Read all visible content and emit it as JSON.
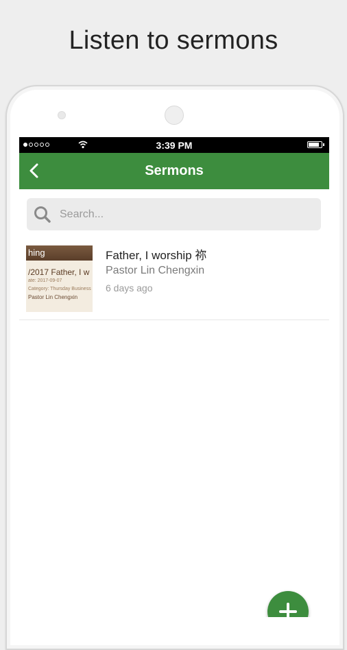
{
  "headline": "Listen to sermons",
  "status_bar": {
    "time": "3:39 PM",
    "signal_icon": "signal-dots-icon",
    "wifi_icon": "wifi-icon",
    "battery_icon": "battery-icon"
  },
  "app_bar": {
    "title": "Sermons",
    "back_icon": "chevron-left-icon",
    "color": "#3d8d3e"
  },
  "search": {
    "placeholder": "Search...",
    "value": "",
    "icon": "search-icon"
  },
  "sermons": [
    {
      "title": "Father, I worship 祢",
      "author": "Pastor Lin Chengxin",
      "time": "6 days ago",
      "thumbnail": {
        "band_text": "hing",
        "line1": "/2017 Father, I w",
        "line2": "ate: 2017-09-07",
        "line3": "Category: Thursday Business",
        "line4": "Pastor Lin Chengxin"
      }
    }
  ],
  "fab": {
    "icon": "plus-icon",
    "color": "#3d8d3e"
  }
}
